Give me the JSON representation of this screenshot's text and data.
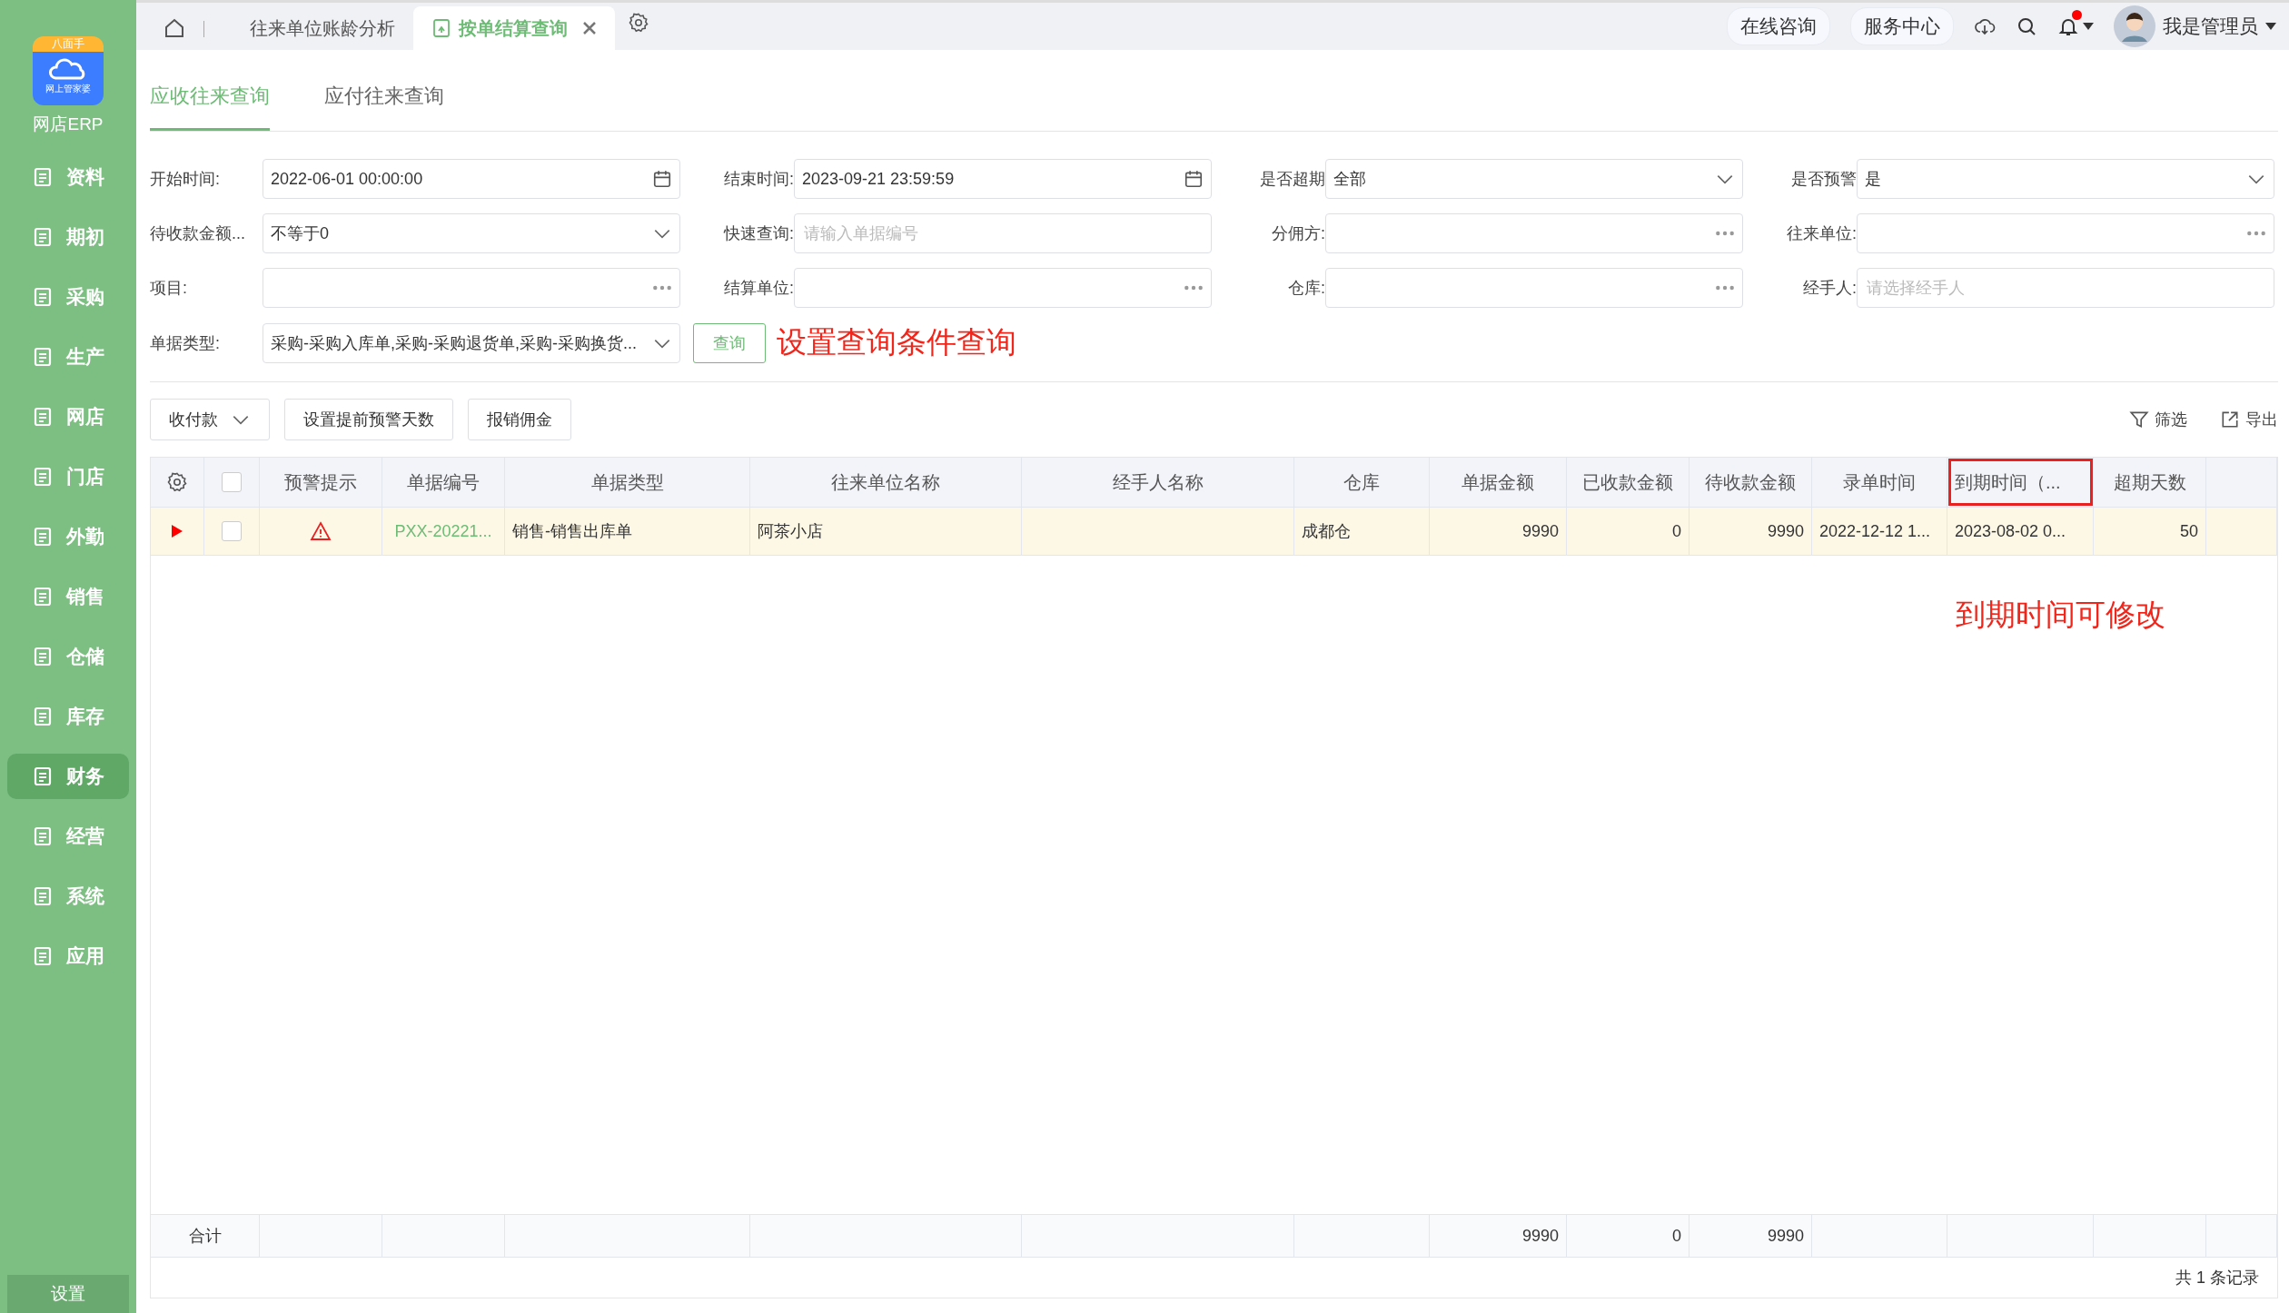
{
  "sidebar": {
    "logo": {
      "badge": "八面手",
      "subtitle": "网上管家婆",
      "name": "网店ERP"
    },
    "items": [
      {
        "label": "资料",
        "selected": false
      },
      {
        "label": "期初",
        "selected": false
      },
      {
        "label": "采购",
        "selected": false
      },
      {
        "label": "生产",
        "selected": false
      },
      {
        "label": "网店",
        "selected": false
      },
      {
        "label": "门店",
        "selected": false
      },
      {
        "label": "外勤",
        "selected": false
      },
      {
        "label": "销售",
        "selected": false
      },
      {
        "label": "仓储",
        "selected": false
      },
      {
        "label": "库存",
        "selected": false
      },
      {
        "label": "财务",
        "selected": true
      },
      {
        "label": "经营",
        "selected": false
      },
      {
        "label": "系统",
        "selected": false
      },
      {
        "label": "应用",
        "selected": false
      }
    ],
    "footer": "设置"
  },
  "topbar": {
    "tabs": [
      {
        "label": "往来单位账龄分析",
        "selected": false,
        "closable": false
      },
      {
        "label": "按单结算查询",
        "selected": true,
        "closable": true
      }
    ],
    "buttons": [
      "在线咨询",
      "服务中心"
    ],
    "has_unread": true,
    "user": "我是管理员"
  },
  "subtabs": [
    {
      "label": "应收往来查询",
      "selected": true
    },
    {
      "label": "应付往来查询",
      "selected": false
    }
  ],
  "filters": [
    {
      "label": "开始时间:",
      "kind": "date",
      "value": "2022-06-01 00:00:00"
    },
    {
      "label": "结束时间:",
      "kind": "date",
      "value": "2023-09-21 23:59:59"
    },
    {
      "label": "是否超期",
      "kind": "select",
      "value": "全部"
    },
    {
      "label": "是否预警",
      "kind": "select",
      "value": "是"
    },
    {
      "label": "待收款金额...",
      "kind": "select",
      "value": "不等于0"
    },
    {
      "label": "快速查询:",
      "kind": "input",
      "placeholder": "请输入单据编号"
    },
    {
      "label": "分佣方:",
      "kind": "lookup"
    },
    {
      "label": "往来单位:",
      "kind": "lookup"
    },
    {
      "label": "项目:",
      "kind": "lookup"
    },
    {
      "label": "结算单位:",
      "kind": "lookup"
    },
    {
      "label": "仓库:",
      "kind": "lookup"
    },
    {
      "label": "经手人:",
      "kind": "input",
      "placeholder": "请选择经手人"
    },
    {
      "label": "单据类型:",
      "kind": "select",
      "value": "采购-采购入库单,采购-采购退货单,采购-采购换货..."
    }
  ],
  "query_button": "查询",
  "annotations": [
    "设置查询条件查询",
    "到期时间可修改"
  ],
  "toolbar": {
    "dropdown": "收付款",
    "buttons": [
      "设置提前预警天数",
      "报销佣金"
    ],
    "filter": "筛选",
    "export": "导出"
  },
  "table": {
    "select_all_checked": false,
    "columns": [
      {
        "label": "预警提示",
        "kind": "icon",
        "highlighted": false
      },
      {
        "label": "单据编号",
        "kind": "link",
        "highlighted": false
      },
      {
        "label": "单据类型",
        "kind": "text",
        "highlighted": false
      },
      {
        "label": "往来单位名称",
        "kind": "text",
        "highlighted": false
      },
      {
        "label": "经手人名称",
        "kind": "text",
        "highlighted": false
      },
      {
        "label": "仓库",
        "kind": "text",
        "highlighted": false
      },
      {
        "label": "单据金额",
        "kind": "number",
        "highlighted": false,
        "total": "9990"
      },
      {
        "label": "已收款金额",
        "kind": "number",
        "highlighted": false,
        "total": "0"
      },
      {
        "label": "待收款金额",
        "kind": "number",
        "highlighted": false,
        "total": "9990"
      },
      {
        "label": "录单时间",
        "kind": "text",
        "highlighted": false
      },
      {
        "label": "到期时间（...",
        "kind": "text",
        "highlighted": true
      },
      {
        "label": "超期天数",
        "kind": "number",
        "highlighted": false
      }
    ],
    "rows": [
      {
        "current": true,
        "checked": false,
        "warning": true,
        "cells": [
          null,
          "PXX-20221...",
          "销售-销售出库单",
          "阿茶小店",
          null,
          "成都仓",
          "9990",
          "0",
          "9990",
          "2022-12-12 1...",
          "2023-08-02 0...",
          "50"
        ]
      }
    ],
    "summary_label": "合计",
    "footer": "共 1 条记录"
  }
}
